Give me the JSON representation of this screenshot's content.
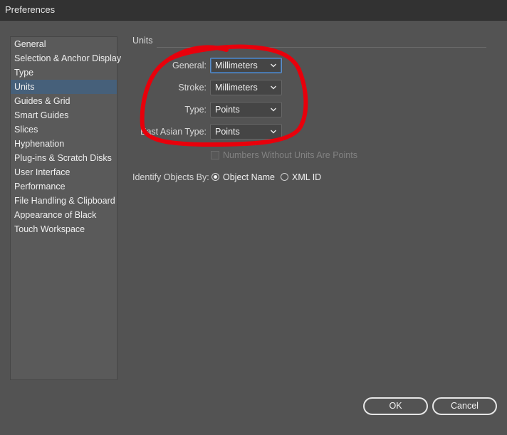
{
  "window": {
    "title": "Preferences"
  },
  "sidebar": {
    "items": [
      {
        "label": "General"
      },
      {
        "label": "Selection & Anchor Display"
      },
      {
        "label": "Type"
      },
      {
        "label": "Units",
        "selected": true
      },
      {
        "label": "Guides & Grid"
      },
      {
        "label": "Smart Guides"
      },
      {
        "label": "Slices"
      },
      {
        "label": "Hyphenation"
      },
      {
        "label": "Plug-ins & Scratch Disks"
      },
      {
        "label": "User Interface"
      },
      {
        "label": "Performance"
      },
      {
        "label": "File Handling & Clipboard"
      },
      {
        "label": "Appearance of Black"
      },
      {
        "label": "Touch Workspace"
      }
    ]
  },
  "units": {
    "section_title": "Units",
    "general": {
      "label": "General:",
      "value": "Millimeters"
    },
    "stroke": {
      "label": "Stroke:",
      "value": "Millimeters"
    },
    "type": {
      "label": "Type:",
      "value": "Points"
    },
    "east_asian_type": {
      "label": "East Asian Type:",
      "value": "Points"
    },
    "numbers_without_units": {
      "label": "Numbers Without Units Are Points",
      "checked": false,
      "enabled": false
    }
  },
  "identify": {
    "label": "Identify Objects By:",
    "options": [
      {
        "label": "Object Name",
        "selected": true
      },
      {
        "label": "XML ID",
        "selected": false
      }
    ]
  },
  "buttons": {
    "ok": "OK",
    "cancel": "Cancel"
  },
  "colors": {
    "background": "#535353",
    "selection": "#46607a",
    "annotation": "#e8000b"
  }
}
